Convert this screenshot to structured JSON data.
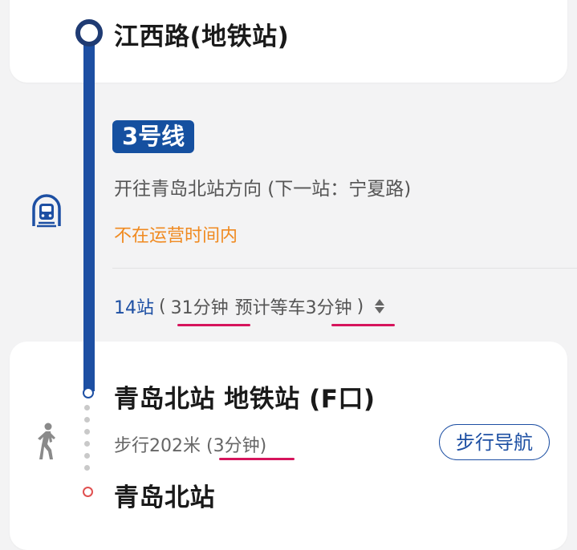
{
  "start_stop": {
    "name": "江西路(地铁站)"
  },
  "transit": {
    "line_badge": "3号线",
    "direction": "开往青岛北站方向 (下一站：宁夏路)",
    "status": "不在运营时间内",
    "stops_count": "14站",
    "paren_open": "(",
    "ride_time": "31分钟",
    "wait_label": "预计等车",
    "wait_time": "3分钟",
    "paren_close": ")"
  },
  "exit_stop": {
    "name": "青岛北站 地铁站 (F口)"
  },
  "walk": {
    "distance": "步行202米",
    "duration": "(3分钟)",
    "nav_button": "步行导航"
  },
  "end_stop": {
    "name": "青岛北站"
  },
  "colors": {
    "route_blue": "#1d4fa3",
    "badge_blue": "#1550a0",
    "status_orange": "#f08a20",
    "highlight_underline": "#d6145c",
    "end_marker_red": "#e05050"
  },
  "icons": [
    "subway-icon",
    "walk-icon",
    "sort-toggle-icon"
  ]
}
